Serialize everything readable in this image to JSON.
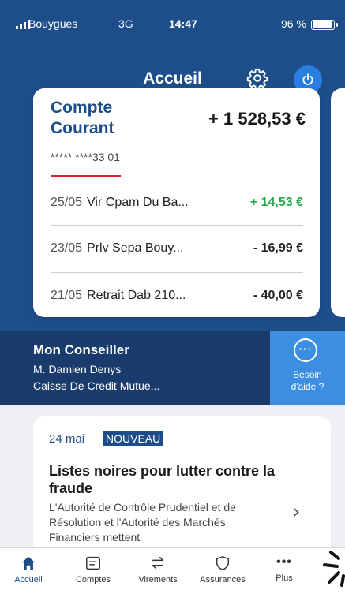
{
  "status_bar": {
    "carrier": "Bouygues",
    "network": "3G",
    "time": "14:47",
    "battery": "96 %",
    "battery_level": 0.96
  },
  "header": {
    "title": "Accueil",
    "settings_icon": "gear-icon",
    "power_icon": "power-icon"
  },
  "account": {
    "name": "Compte Courant",
    "balance": "+ 1 528,53 €",
    "number": "***** ****33 01",
    "transactions": [
      {
        "date": "25/05",
        "label": "Vir Cpam Du Ba...",
        "amount": "+ 14,53 €"
      },
      {
        "date": "23/05",
        "label": "Prlv Sepa Bouy...",
        "amount": "- 16,99 €"
      },
      {
        "date": "21/05",
        "label": "Retrait Dab 210...",
        "amount": "- 40,00 €"
      }
    ]
  },
  "advisor": {
    "title": "Mon Conseiller",
    "name": "M. Damien Denys",
    "bank": "Caisse De Credit Mutue...",
    "help_line1": "Besoin",
    "help_line2": "d'aide ?"
  },
  "news": {
    "date": "24 mai",
    "badge": "NOUVEAU",
    "headline": "Listes noires pour lutter contre la fraude",
    "body": "L'Autorité de Contrôle Prudentiel et de Résolution et l'Autorité des Marchés Financiers mettent"
  },
  "tabs": [
    {
      "label": "Accueil",
      "icon": "home-icon"
    },
    {
      "label": "Comptes",
      "icon": "card-icon"
    },
    {
      "label": "Virements",
      "icon": "transfer-icon"
    },
    {
      "label": "Assurances",
      "icon": "shield-icon"
    },
    {
      "label": "Plus",
      "icon": "more-icon"
    }
  ],
  "colors": {
    "primary": "#1d4e89",
    "advisor_band": "#1a3c6c",
    "help_button": "#3c8fe0",
    "positive": "#2aa84a",
    "accent_red": "#d7222c"
  }
}
